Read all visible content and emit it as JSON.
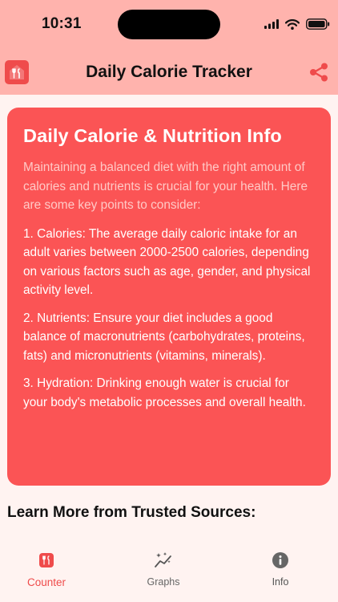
{
  "status_bar": {
    "time": "10:31"
  },
  "nav": {
    "title": "Daily Calorie Tracker"
  },
  "card": {
    "title": "Daily Calorie & Nutrition Info",
    "intro": "Maintaining a balanced diet with the right amount of calories and nutrients is crucial for your health. Here are some key points to consider:",
    "points": [
      "1. Calories: The average daily caloric intake for an adult varies between 2000-2500 calories, depending on various factors such as age, gender, and physical activity level.",
      "2. Nutrients: Ensure your diet includes a good balance of macronutrients (carbohydrates, proteins, fats) and micronutrients (vitamins, minerals).",
      "3. Hydration: Drinking enough water is crucial for your body's metabolic processes and overall health."
    ]
  },
  "learn_more": {
    "heading": "Learn More from Trusted Sources:"
  },
  "tabbar": {
    "tabs": [
      {
        "label": "Counter",
        "icon": "fork-knife-house-icon",
        "selected": true
      },
      {
        "label": "Graphs",
        "icon": "chart-sparkle-icon",
        "selected": false
      },
      {
        "label": "Info",
        "icon": "info-circle-icon",
        "selected": false
      }
    ]
  },
  "colors": {
    "header_bg": "#ffb3ad",
    "page_bg": "#fff3f1",
    "accent": "#ef4b4b",
    "card_bg": "#fb5455",
    "card_intro_text": "#ffc9c6"
  }
}
